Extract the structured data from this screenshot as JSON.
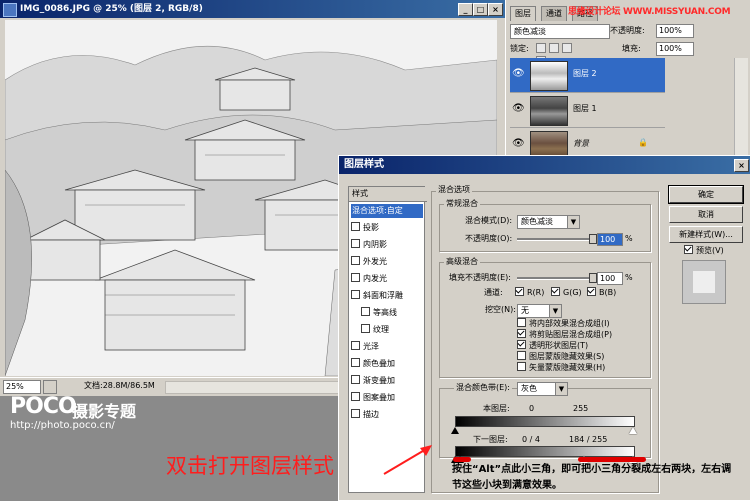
{
  "document": {
    "title": "IMG_0086.JPG @ 25% (图层 2, RGB/8)",
    "zoom": "25%",
    "doc_size": "文档:28.8M/86.5M"
  },
  "layers_panel": {
    "tabs": [
      "图层",
      "通道",
      "路径"
    ],
    "watermark": "思缘设计论坛 WWW.MISSYUAN.COM",
    "blend_mode": "颜色减淡",
    "opacity_label": "不透明度:",
    "opacity_value": "100%",
    "lock_label": "锁定:",
    "fill_label": "填充:",
    "fill_value": "100%",
    "layers": [
      {
        "name": "图层 2",
        "selected": true
      },
      {
        "name": "图层 1",
        "selected": false
      },
      {
        "name": "背景",
        "selected": false
      }
    ]
  },
  "dialog": {
    "title": "图层样式",
    "style_list": {
      "header": "样式",
      "items": [
        {
          "label": "混合选项:自定",
          "checkbox": false,
          "selected": true,
          "indent": false
        },
        {
          "label": "投影",
          "checkbox": true,
          "indent": false
        },
        {
          "label": "内阴影",
          "checkbox": true,
          "indent": false
        },
        {
          "label": "外发光",
          "checkbox": true,
          "indent": false
        },
        {
          "label": "内发光",
          "checkbox": true,
          "indent": false
        },
        {
          "label": "斜面和浮雕",
          "checkbox": true,
          "indent": false
        },
        {
          "label": "等高线",
          "checkbox": true,
          "indent": true
        },
        {
          "label": "纹理",
          "checkbox": true,
          "indent": true
        },
        {
          "label": "光泽",
          "checkbox": true,
          "indent": false
        },
        {
          "label": "颜色叠加",
          "checkbox": true,
          "indent": false
        },
        {
          "label": "渐变叠加",
          "checkbox": true,
          "indent": false
        },
        {
          "label": "图案叠加",
          "checkbox": true,
          "indent": false
        },
        {
          "label": "描边",
          "checkbox": true,
          "indent": false
        }
      ]
    },
    "blend_options": {
      "group_label": "混合选项",
      "general_label": "常规混合",
      "blend_mode_label": "混合模式(D):",
      "blend_mode_value": "颜色减淡",
      "opacity_label": "不透明度(O):",
      "opacity_value": "100",
      "percent": "%",
      "advanced_label": "高级混合",
      "fill_opacity_label": "填充不透明度(E):",
      "fill_opacity_value": "100",
      "channels_label": "通道:",
      "channel_r": "R(R)",
      "channel_g": "G(G)",
      "channel_b": "B(B)",
      "knockout_label": "挖空(N):",
      "knockout_value": "无",
      "checkboxes": [
        {
          "label": "将内部效果混合成组(I)",
          "checked": false
        },
        {
          "label": "将剪贴图层混合成组(P)",
          "checked": true
        },
        {
          "label": "透明形状图层(T)",
          "checked": true
        },
        {
          "label": "图层蒙版隐藏效果(S)",
          "checked": false
        },
        {
          "label": "矢量蒙版隐藏效果(H)",
          "checked": false
        }
      ],
      "blend_if_label": "混合颜色带(E):",
      "blend_if_value": "灰色",
      "this_layer_label": "本图层:",
      "this_layer_low": "0",
      "this_layer_high": "255",
      "underlying_label": "下一图层:",
      "underlying_low": "0 / 4",
      "underlying_high": "184 / 255"
    },
    "buttons": {
      "ok": "确定",
      "cancel": "取消",
      "new_style": "新建样式(W)...",
      "preview": "预览(V)"
    },
    "bottom_note": "按住“Alt”点此小三角，即可把小三角分裂成左右两块，左右调节这些小块到满意效果。"
  },
  "annotation": {
    "text": "双击打开图层样式",
    "color": "#ff1d1d"
  },
  "branding": {
    "logo": "POCO",
    "logo_sub": "摄影专题",
    "url": "http://photo.poco.cn/"
  }
}
